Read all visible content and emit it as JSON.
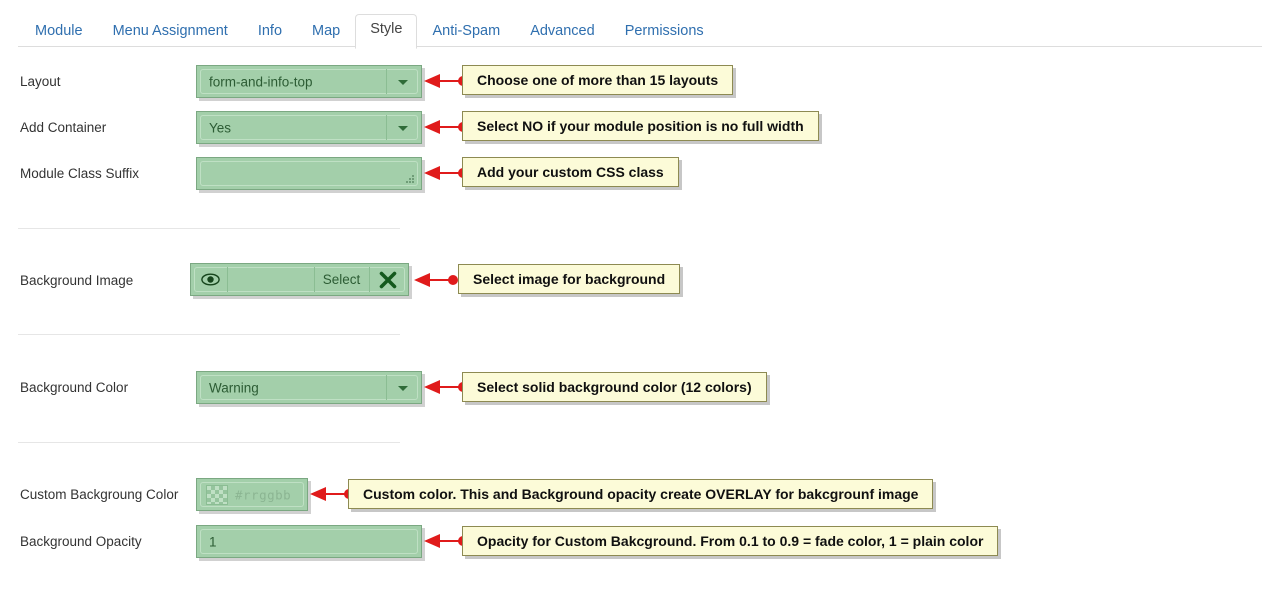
{
  "tabs": [
    {
      "label": "Module",
      "active": false
    },
    {
      "label": "Menu Assignment",
      "active": false
    },
    {
      "label": "Info",
      "active": false
    },
    {
      "label": "Map",
      "active": false
    },
    {
      "label": "Style",
      "active": true
    },
    {
      "label": "Anti-Spam",
      "active": false
    },
    {
      "label": "Advanced",
      "active": false
    },
    {
      "label": "Permissions",
      "active": false
    }
  ],
  "fields": {
    "layout": {
      "label": "Layout",
      "value": "form-and-info-top",
      "type": "select"
    },
    "add_container": {
      "label": "Add Container",
      "value": "Yes",
      "type": "select"
    },
    "module_class": {
      "label": "Module Class Suffix",
      "value": "",
      "type": "textarea"
    },
    "background_image": {
      "label": "Background Image",
      "value": "",
      "type": "media",
      "select_label": "Select",
      "preview_icon": "eye-icon",
      "clear_icon": "clear-x-icon"
    },
    "background_color": {
      "label": "Background Color",
      "value": "Warning",
      "type": "select"
    },
    "custom_bg_color": {
      "label": "Custom Backgroung Color",
      "value": "",
      "type": "color",
      "placeholder": "#rrggbb"
    },
    "background_opacity": {
      "label": "Background Opacity",
      "value": "1",
      "type": "text"
    }
  },
  "callouts": {
    "layout": "Choose one of more than 15 layouts",
    "add_container": "Select NO if your module position is no full width",
    "module_class": "Add your custom CSS class",
    "background_image": "Select image for background",
    "background_color": "Select solid background color (12 colors)",
    "custom_bg_color": "Custom color. This and Background opacity create OVERLAY for bakcgrounf image",
    "background_opacity": "Opacity for Custom Bakcground. From 0.1 to 0.9 = fade color, 1 = plain color"
  },
  "colors": {
    "field_bg": "#a3cfaa",
    "field_border": "#7ba882",
    "callout_bg": "#fcfbd8",
    "callout_border": "#8d8a52",
    "pointer": "#e01b1b",
    "tab_link": "#2f6faf"
  }
}
